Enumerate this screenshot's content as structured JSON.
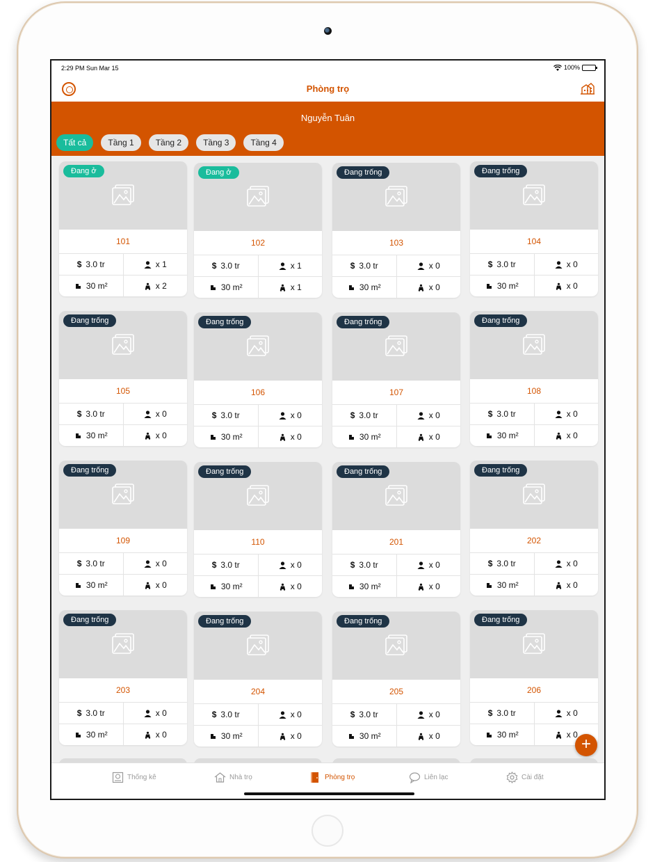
{
  "status": {
    "time": "2:29 PM  Sun Mar 15",
    "battery": "100%"
  },
  "nav": {
    "title": "Phòng trọ",
    "left_icon": "app-logo-icon",
    "right_icon": "building-icon"
  },
  "owner": {
    "name": "Nguyễn Tuân"
  },
  "floor_tabs": [
    "Tất cả",
    "Tầng 1",
    "Tầng 2",
    "Tầng 3",
    "Tầng 4"
  ],
  "active_tab": "Tất cả",
  "rooms": [
    {
      "status": "Đang ở",
      "occupied": true,
      "number": "101",
      "price": "3.0 tr",
      "people": "x 1",
      "area": "30 m²",
      "vehicles": "x 2"
    },
    {
      "status": "Đang ở",
      "occupied": true,
      "number": "102",
      "price": "3.0 tr",
      "people": "x 1",
      "area": "30 m²",
      "vehicles": "x 1"
    },
    {
      "status": "Đang trống",
      "occupied": false,
      "number": "103",
      "price": "3.0 tr",
      "people": "x 0",
      "area": "30 m²",
      "vehicles": "x 0"
    },
    {
      "status": "Đang trống",
      "occupied": false,
      "number": "104",
      "price": "3.0 tr",
      "people": "x 0",
      "area": "30 m²",
      "vehicles": "x 0"
    },
    {
      "status": "Đang trống",
      "occupied": false,
      "number": "105",
      "price": "3.0 tr",
      "people": "x 0",
      "area": "30 m²",
      "vehicles": "x 0"
    },
    {
      "status": "Đang trống",
      "occupied": false,
      "number": "106",
      "price": "3.0 tr",
      "people": "x 0",
      "area": "30 m²",
      "vehicles": "x 0"
    },
    {
      "status": "Đang trống",
      "occupied": false,
      "number": "107",
      "price": "3.0 tr",
      "people": "x 0",
      "area": "30 m²",
      "vehicles": "x 0"
    },
    {
      "status": "Đang trống",
      "occupied": false,
      "number": "108",
      "price": "3.0 tr",
      "people": "x 0",
      "area": "30 m²",
      "vehicles": "x 0"
    },
    {
      "status": "Đang trống",
      "occupied": false,
      "number": "109",
      "price": "3.0 tr",
      "people": "x 0",
      "area": "30 m²",
      "vehicles": "x 0"
    },
    {
      "status": "Đang trống",
      "occupied": false,
      "number": "110",
      "price": "3.0 tr",
      "people": "x 0",
      "area": "30 m²",
      "vehicles": "x 0"
    },
    {
      "status": "Đang trống",
      "occupied": false,
      "number": "201",
      "price": "3.0 tr",
      "people": "x 0",
      "area": "30 m²",
      "vehicles": "x 0"
    },
    {
      "status": "Đang trống",
      "occupied": false,
      "number": "202",
      "price": "3.0 tr",
      "people": "x 0",
      "area": "30 m²",
      "vehicles": "x 0"
    },
    {
      "status": "Đang trống",
      "occupied": false,
      "number": "203",
      "price": "3.0 tr",
      "people": "x 0",
      "area": "30 m²",
      "vehicles": "x 0"
    },
    {
      "status": "Đang trống",
      "occupied": false,
      "number": "204",
      "price": "3.0 tr",
      "people": "x 0",
      "area": "30 m²",
      "vehicles": "x 0"
    },
    {
      "status": "Đang trống",
      "occupied": false,
      "number": "205",
      "price": "3.0 tr",
      "people": "x 0",
      "area": "30 m²",
      "vehicles": "x 0"
    },
    {
      "status": "Đang trống",
      "occupied": false,
      "number": "206",
      "price": "3.0 tr",
      "people": "x 0",
      "area": "30 m²",
      "vehicles": "x 0"
    }
  ],
  "tabbar": [
    {
      "label": "Thống kê",
      "icon": "stats-icon",
      "active": false
    },
    {
      "label": "Nhà trọ",
      "icon": "house-icon",
      "active": false
    },
    {
      "label": "Phòng trọ",
      "icon": "door-icon",
      "active": true
    },
    {
      "label": "Liên lạc",
      "icon": "chat-icon",
      "active": false
    },
    {
      "label": "Cài đặt",
      "icon": "gear-icon",
      "active": false
    }
  ],
  "colors": {
    "accent": "#d35400",
    "occupied": "#1abc9c",
    "vacant": "#1f3446"
  }
}
